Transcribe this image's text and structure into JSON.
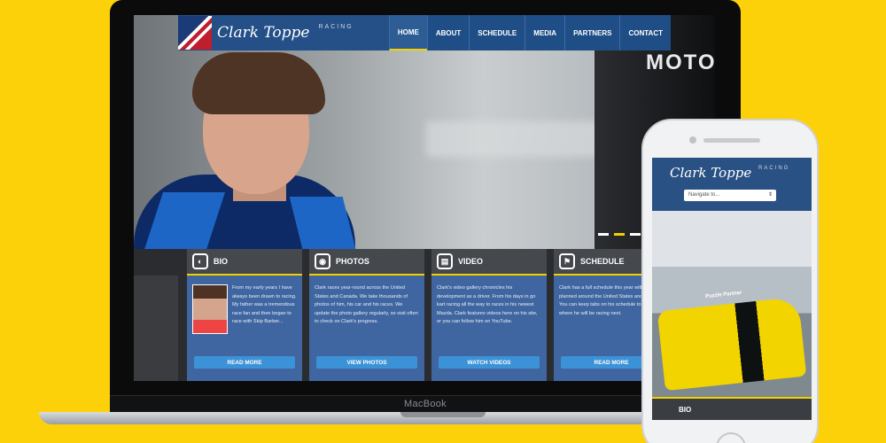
{
  "laptop": {
    "brand_label": "MacBook"
  },
  "site": {
    "logo_script": "Clark Toppe",
    "logo_racing": "RACING",
    "nav": {
      "home": "HOME",
      "about": "ABOUT",
      "schedule": "SCHEDULE",
      "media": "MEDIA",
      "partners": "PARTNERS",
      "contact": "CONTACT"
    },
    "hero": {
      "background_sign": "MOTO"
    },
    "cards": [
      {
        "title": "BIO",
        "icon": "helmet-icon",
        "text": "From my early years I have always been drawn to racing. My father was a tremendous race fan and then began to race with Skip Barber...",
        "button": "READ MORE"
      },
      {
        "title": "PHOTOS",
        "icon": "camera-icon",
        "text": "Clark races year-round across the United States and Canada. We take thousands of photos of him, his car and his races. We update the photo gallery regularly, so visit often to check on Clark's progress.",
        "button": "VIEW PHOTOS"
      },
      {
        "title": "VIDEO",
        "icon": "video-icon",
        "text": "Clark's video gallery chronicles his development as a driver. From his days in go kart racing all the way to races in his newest Mazda. Clark features videos here on his site, or you can follow him on YouTube.",
        "button": "WATCH VIDEOS"
      },
      {
        "title": "SCHEDULE",
        "icon": "checkered-flag-icon",
        "text": "Clark has a full schedule this year with races planned around the United States and Canada. You can keep tabs on his schedule to see where he will be racing next.",
        "button": "READ MORE"
      }
    ]
  },
  "mobile": {
    "logo_script": "Clark Toppe",
    "logo_racing": "RACING",
    "select_placeholder": "Navigate to...",
    "car_sponsor": "Puzzle Partner",
    "bio_label": "BIO"
  },
  "colors": {
    "background": "#fdd10a",
    "nav_blue": "#1f4e86",
    "card_blue": "#3f66a0",
    "button_blue": "#3c92d6",
    "accent_yellow": "#f3d000"
  }
}
